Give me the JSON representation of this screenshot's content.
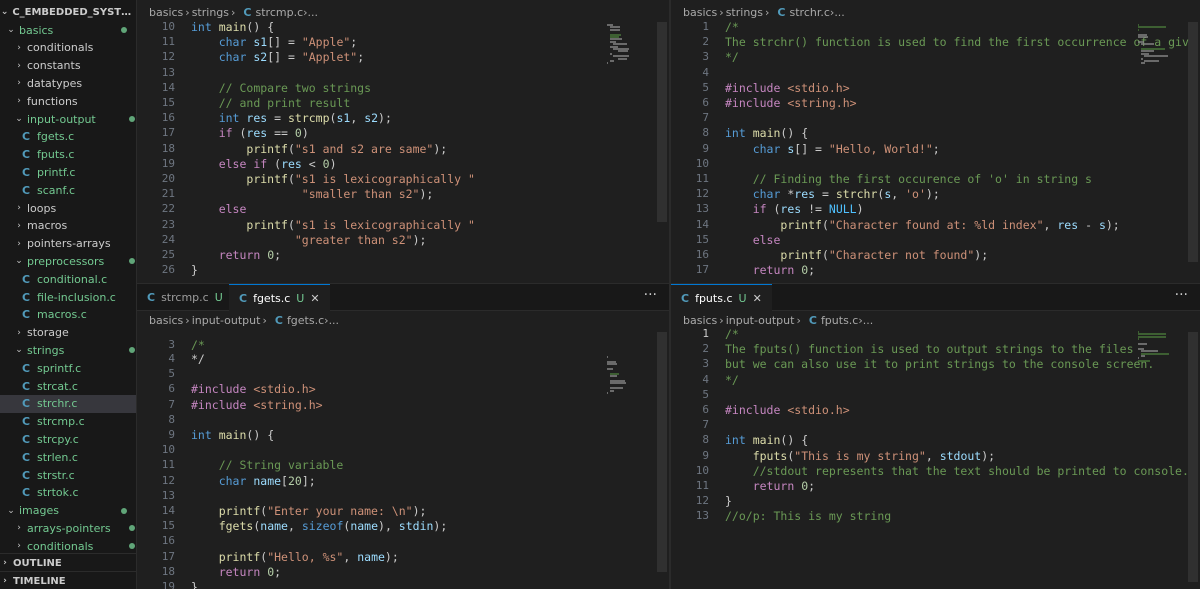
{
  "explorer": {
    "root_label": "C_EMBEDDED_SYSTEMS",
    "items": [
      {
        "label": "basics",
        "type": "folder",
        "open": true,
        "depth": 1,
        "dot": true
      },
      {
        "label": "conditionals",
        "type": "folder",
        "open": false,
        "depth": 2
      },
      {
        "label": "constants",
        "type": "folder",
        "open": false,
        "depth": 2
      },
      {
        "label": "datatypes",
        "type": "folder",
        "open": false,
        "depth": 2
      },
      {
        "label": "functions",
        "type": "folder",
        "open": false,
        "depth": 2
      },
      {
        "label": "input-output",
        "type": "folder",
        "open": true,
        "depth": 2,
        "dot": true
      },
      {
        "label": "fgets.c",
        "type": "file",
        "depth": 3,
        "status": "U"
      },
      {
        "label": "fputs.c",
        "type": "file",
        "depth": 3,
        "status": "U"
      },
      {
        "label": "printf.c",
        "type": "file",
        "depth": 3,
        "status": "U"
      },
      {
        "label": "scanf.c",
        "type": "file",
        "depth": 3,
        "status": "U"
      },
      {
        "label": "loops",
        "type": "folder",
        "open": false,
        "depth": 2
      },
      {
        "label": "macros",
        "type": "folder",
        "open": false,
        "depth": 2
      },
      {
        "label": "pointers-arrays",
        "type": "folder",
        "open": false,
        "depth": 2
      },
      {
        "label": "preprocessors",
        "type": "folder",
        "open": true,
        "depth": 2,
        "dot": true
      },
      {
        "label": "conditional.c",
        "type": "file",
        "depth": 3,
        "status": "U"
      },
      {
        "label": "file-inclusion.c",
        "type": "file",
        "depth": 3,
        "status": "U"
      },
      {
        "label": "macros.c",
        "type": "file",
        "depth": 3,
        "status": "U"
      },
      {
        "label": "storage",
        "type": "folder",
        "open": false,
        "depth": 2
      },
      {
        "label": "strings",
        "type": "folder",
        "open": true,
        "depth": 2,
        "dot": true
      },
      {
        "label": "sprintf.c",
        "type": "file",
        "depth": 3,
        "status": "U"
      },
      {
        "label": "strcat.c",
        "type": "file",
        "depth": 3,
        "status": "U"
      },
      {
        "label": "strchr.c",
        "type": "file",
        "depth": 3,
        "status": "U",
        "selected": true
      },
      {
        "label": "strcmp.c",
        "type": "file",
        "depth": 3,
        "status": "U"
      },
      {
        "label": "strcpy.c",
        "type": "file",
        "depth": 3,
        "status": "U"
      },
      {
        "label": "strlen.c",
        "type": "file",
        "depth": 3,
        "status": "U"
      },
      {
        "label": "strstr.c",
        "type": "file",
        "depth": 3,
        "status": "U"
      },
      {
        "label": "strtok.c",
        "type": "file",
        "depth": 3,
        "status": "U"
      },
      {
        "label": "images",
        "type": "folder",
        "open": true,
        "depth": 1,
        "dot": true
      },
      {
        "label": "arrays-pointers",
        "type": "folder",
        "open": false,
        "depth": 2,
        "dot": true
      },
      {
        "label": "conditionals",
        "type": "folder",
        "open": false,
        "depth": 2,
        "dot": true
      }
    ],
    "outline_label": "OUTLINE",
    "timeline_label": "TIMELINE"
  },
  "editors": {
    "top_left": {
      "breadcrumb": [
        "basics",
        "strings",
        "strcmp.c",
        "..."
      ],
      "first_line": 10,
      "lines": [
        "int main() {",
        "    char s1[] = \"Apple\";",
        "    char s2[] = \"Applet\";",
        "",
        "    // Compare two strings",
        "    // and print result",
        "    int res = strcmp(s1, s2);",
        "    if (res == 0)",
        "        printf(\"s1 and s2 are same\");",
        "    else if (res < 0)",
        "        printf(\"s1 is lexicographically \"",
        "                \"smaller than s2\");",
        "    else",
        "        printf(\"s1 is lexicographically \"",
        "               \"greater than s2\");",
        "    return 0;",
        "}"
      ]
    },
    "top_right": {
      "breadcrumb": [
        "basics",
        "strings",
        "strchr.c",
        "..."
      ],
      "first_line": 1,
      "lines": [
        "/*",
        "The strchr() function is used to find the first occurrence of a giv",
        "*/",
        "",
        "#include <stdio.h>",
        "#include <string.h>",
        "",
        "int main() {",
        "    char s[] = \"Hello, World!\";",
        "",
        "    // Finding the first occurence of 'o' in string s",
        "    char *res = strchr(s, 'o');",
        "    if (res != NULL)",
        "        printf(\"Character found at: %ld index\", res - s);",
        "    else",
        "        printf(\"Character not found\");",
        "    return 0;"
      ]
    },
    "bottom_left": {
      "tabs": [
        {
          "label": "strcmp.c",
          "status": "U",
          "active": false,
          "close": false
        },
        {
          "label": "fgets.c",
          "status": "U",
          "active": true,
          "close": true
        }
      ],
      "more": "···",
      "breadcrumb": [
        "basics",
        "input-output",
        "fgets.c",
        "..."
      ],
      "first_line": 4,
      "lines": [
        "*/",
        "",
        "#include <stdio.h>",
        "#include <string.h>",
        "",
        "int main() {",
        "",
        "    // String variable",
        "    char name[20];",
        "",
        "    printf(\"Enter your name: \\n\");",
        "    fgets(name, sizeof(name), stdin);",
        "",
        "    printf(\"Hello, %s\", name);",
        "    return 0;",
        "}"
      ],
      "sticky": "/*"
    },
    "bottom_right": {
      "tabs": [
        {
          "label": "fputs.c",
          "status": "U",
          "active": true,
          "close": true
        }
      ],
      "more": "···",
      "breadcrumb": [
        "basics",
        "input-output",
        "fputs.c",
        "..."
      ],
      "first_line": 1,
      "lines": [
        "/*",
        "The fputs() function is used to output strings to the files",
        "but we can also use it to print strings to the console screen.",
        "*/",
        "",
        "#include <stdio.h>",
        "",
        "int main() {",
        "    fputs(\"This is my string\", stdout);",
        "    //stdout represents that the text should be printed to console.",
        "    return 0;",
        "}",
        "//o/p: This is my string"
      ]
    }
  }
}
